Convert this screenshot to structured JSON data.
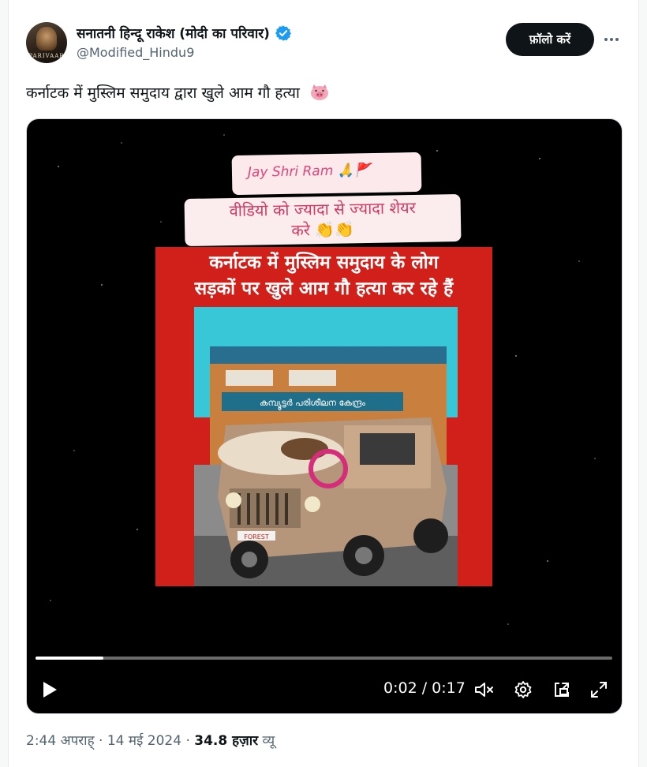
{
  "author": {
    "display_name": "सनातनी हिन्दू राकेश (मोदी का परिवार)",
    "handle": "@Modified_Hindu9",
    "avatar_text": "PARIVAAR",
    "verified": true
  },
  "follow_label": "फ़ॉलो करें",
  "more_icon": "more-horizontal-icon",
  "tweet_text": "कर्नाटक में मुस्लिम समुदाय द्वारा खुले आम गौ हत्या",
  "tweet_emoji": "pig-face",
  "video": {
    "sticker_top": "Jay Shri Ram 🙏🚩",
    "sticker_line1": "वीडियो को ज्यादा से ज्यादा शेयर",
    "sticker_line2": "करे 👏👏",
    "frame_line1": "कर्नाटक में मुस्लिम समुदाय के लोग",
    "frame_line2": "सड़कों पर खुले आम गौ हत्या कर रहे हैं",
    "building_sign": "കമ്പ്യൂട്ടർ പരിശീലന കേന്ദ്രം",
    "plate_text": "FOREST",
    "time_display": "0:02 / 0:17",
    "progress": 0.118,
    "controls": [
      "play-icon",
      "mute-icon",
      "settings-icon",
      "popout-icon",
      "fullscreen-icon"
    ]
  },
  "meta": {
    "time": "2:44 अपराह्",
    "date": "14 मई 2024",
    "views_count": "34.8 हज़ार",
    "views_label": "व्यू"
  },
  "colors": {
    "follow_bg": "#0f1419",
    "verified_blue": "#1d9bf0",
    "frame_red": "#d11f1a",
    "secondary_text": "#536471"
  }
}
